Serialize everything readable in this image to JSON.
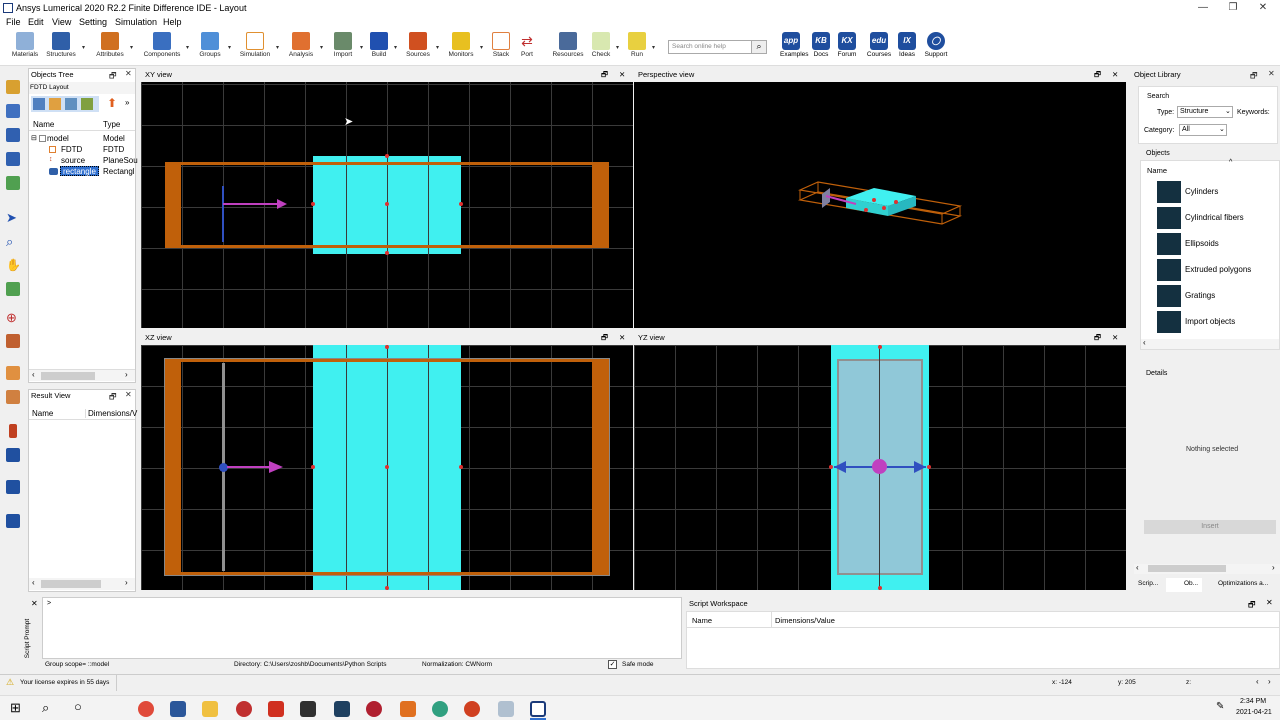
{
  "window": {
    "title": "Ansys Lumerical 2020 R2.2 Finite Difference IDE - Layout",
    "min": "—",
    "max": "❐",
    "close": "✕"
  },
  "menu": [
    "File",
    "Edit",
    "View",
    "Setting",
    "Simulation",
    "Help"
  ],
  "toolbar": {
    "buttons": [
      "Materials",
      "Structures",
      "Attributes",
      "Components",
      "Groups",
      "Simulation",
      "Analysis",
      "Import",
      "Build",
      "Sources",
      "Monitors",
      "Stack",
      "Port",
      "Resources",
      "Check",
      "Run"
    ],
    "search_placeholder": "Search online help",
    "help": [
      {
        "abbr": "app",
        "label": "Examples"
      },
      {
        "abbr": "KB",
        "label": "Docs"
      },
      {
        "abbr": "KX",
        "label": "Forum"
      },
      {
        "abbr": "edu",
        "label": "Courses"
      },
      {
        "abbr": "IX",
        "label": "Ideas"
      },
      {
        "abbr": "◯",
        "label": "Support"
      }
    ]
  },
  "objects_tree": {
    "title": "Objects Tree",
    "layout": "FDTD Layout",
    "col_name": "Name",
    "col_type": "Type",
    "rows": [
      {
        "name": "model",
        "type": "Model"
      },
      {
        "name": "FDTD",
        "type": "FDTD"
      },
      {
        "name": "source",
        "type": "PlaneSou"
      },
      {
        "name": "rectangle",
        "type": "Rectangl"
      }
    ]
  },
  "result_view": {
    "title": "Result View",
    "col_name": "Name",
    "col_dims": "Dimensions/V"
  },
  "views": {
    "xy": "XY view",
    "perspective": "Perspective view",
    "xz": "XZ view",
    "yz": "YZ view"
  },
  "library": {
    "title": "Object Library",
    "search": "Search",
    "type_label": "Type:",
    "type_value": "Structure",
    "keywords_label": "Keywords:",
    "category_label": "Category:",
    "category_value": "All",
    "objects": "Objects",
    "col_name": "Name",
    "items": [
      "Cylinders",
      "Cylindrical fibers",
      "Ellipsoids",
      "Extruded polygons",
      "Gratings",
      "Import objects"
    ],
    "details": "Details",
    "nothing": "Nothing selected",
    "insert": "Insert",
    "tabs": [
      "Scrip...",
      "Ob...",
      "Optimizations a..."
    ]
  },
  "script": {
    "title": "Script Prompt",
    "prompt": ">"
  },
  "workspace": {
    "title": "Script Workspace",
    "col_name": "Name",
    "col_dims": "Dimensions/Value"
  },
  "status": {
    "scope": "Group scope= ::model",
    "directory": "Directory: C:\\Users\\zoshb\\Documents\\Python Scripts",
    "normalization": "Normalization: CWNorm",
    "safe": "Safe mode",
    "license": "Your license expires in 55 days",
    "x": "x: -124",
    "y": "y: 205",
    "z": "z:"
  },
  "clock": {
    "time": "2:34 PM",
    "date": "2021-04-21"
  },
  "colors": {
    "fdtd_orange": "#c0600a",
    "rect_cyan": "#40f0f0",
    "source_magenta": "#c040c0",
    "source_blue": "#3050c0"
  }
}
